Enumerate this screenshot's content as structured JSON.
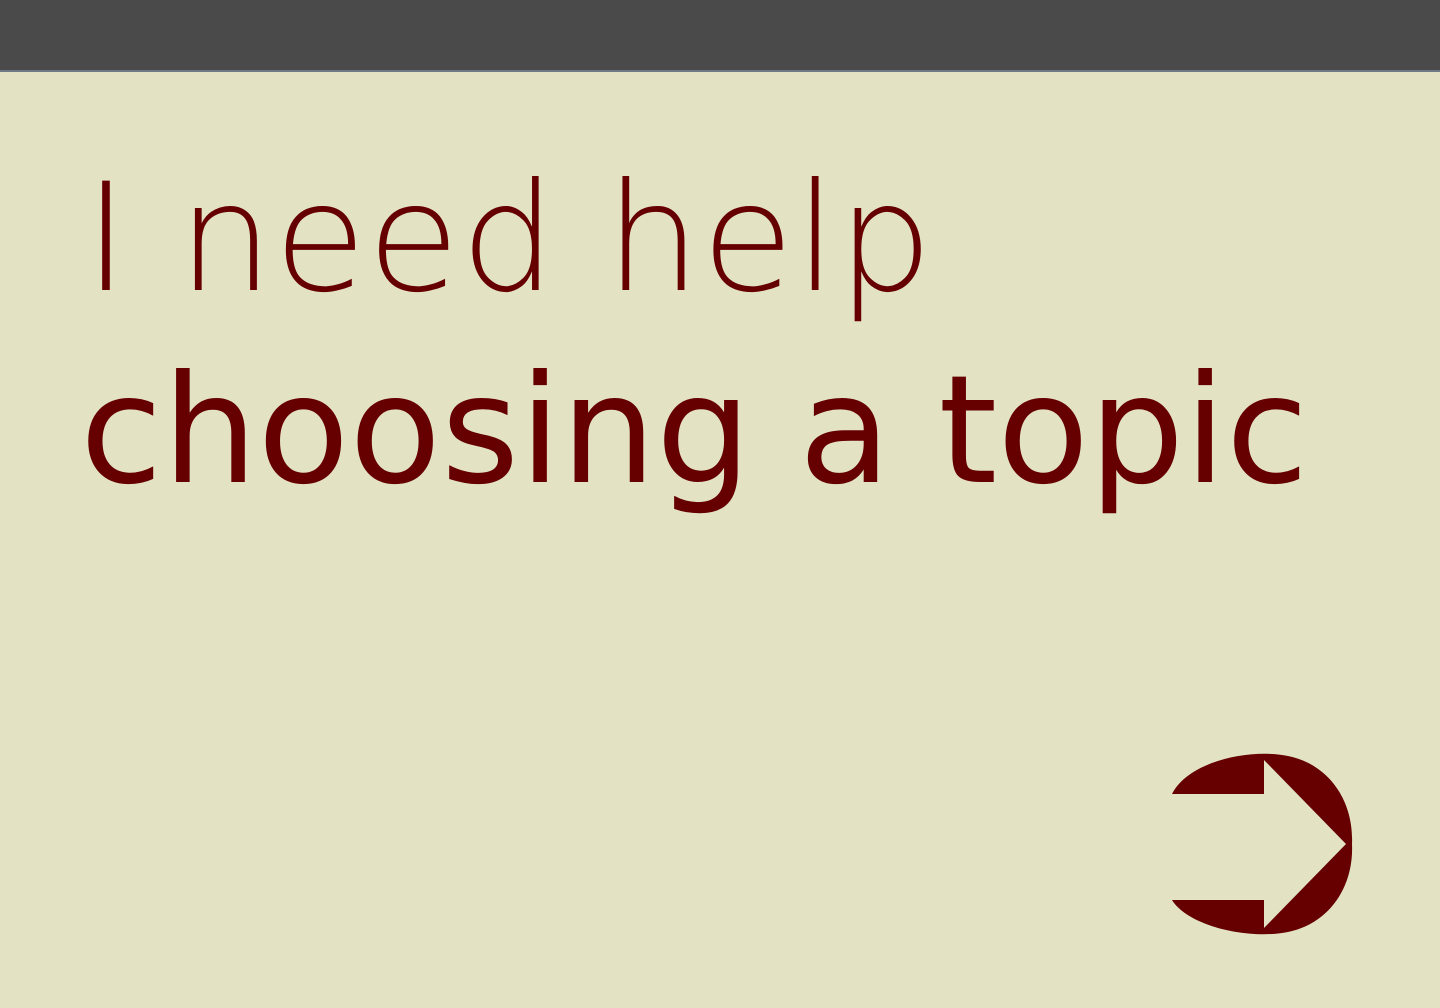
{
  "header": {
    "bar_color": "#4a4a4a"
  },
  "main": {
    "heading_line1": "I need help",
    "heading_line2": "choosing a topic",
    "text_color": "#660000",
    "background_color": "#e3e3c3"
  },
  "navigation": {
    "next_icon": "arrow-right-icon"
  }
}
